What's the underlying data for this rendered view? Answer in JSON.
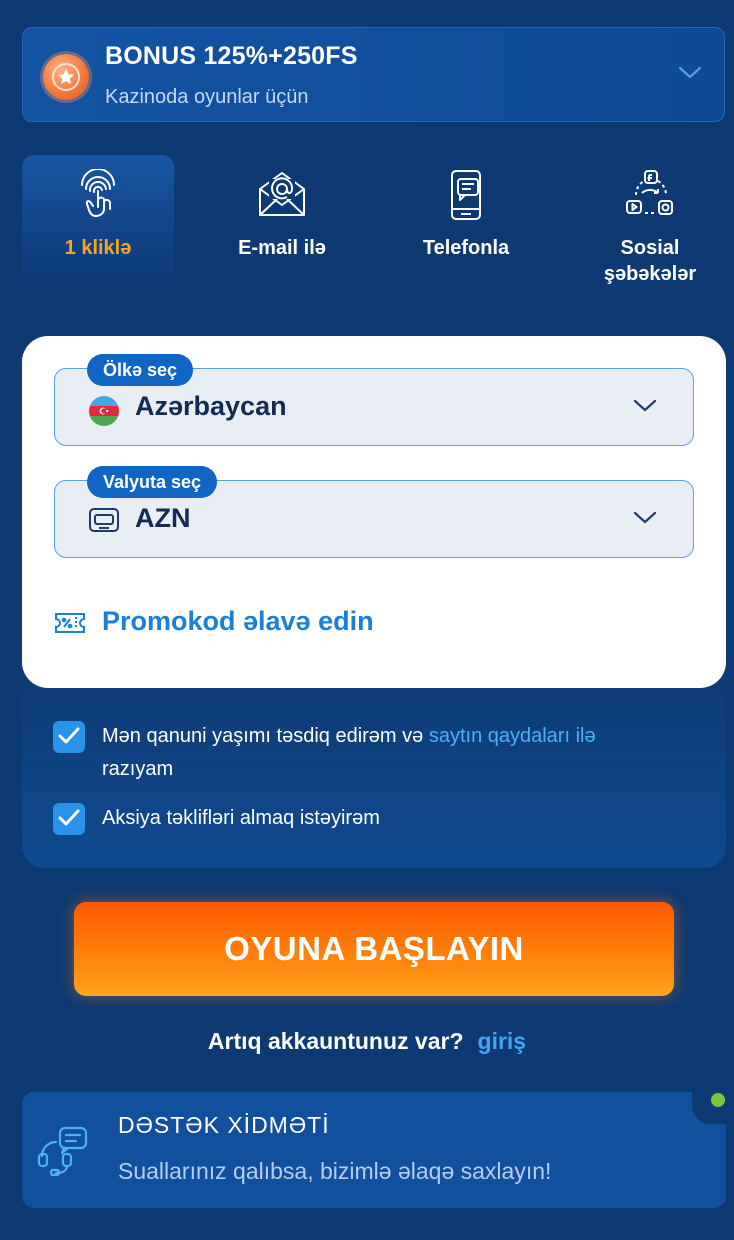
{
  "bonus": {
    "title": "BONUS 125%+250FS",
    "subtitle": "Kazinoda oyunlar üçün",
    "icon": "star-medal-icon"
  },
  "tabs": [
    {
      "label": "1 kliklə",
      "icon": "fingerprint-tap-icon",
      "active": true
    },
    {
      "label": "E-mail ilə",
      "icon": "email-envelope-icon",
      "active": false
    },
    {
      "label": "Telefonla",
      "icon": "phone-icon",
      "active": false
    },
    {
      "label": "Sosial şəbəkələr",
      "icon": "social-networks-icon",
      "active": false
    }
  ],
  "form": {
    "country": {
      "label": "Ölkə seç",
      "value": "Azərbaycan",
      "icon": "azerbaijan-flag-icon"
    },
    "currency": {
      "label": "Valyuta seç",
      "value": "AZN",
      "icon": "currency-card-icon"
    },
    "promo": {
      "label": "Promokod əlavə edin",
      "icon": "promo-ticket-icon"
    }
  },
  "checkboxes": {
    "age": {
      "text": "Mən qanuni yaşımı təsdiq edirəm və ",
      "link": "saytın qaydaları ilə",
      "text_end": "razıyam",
      "checked": true
    },
    "promo": {
      "text": "Aksiya təklifləri almaq istəyirəm",
      "checked": true
    }
  },
  "cta": {
    "label": "OYUNA BAŞLAYIN"
  },
  "login": {
    "question": "Artıq akkauntunuz var?",
    "link": "giriş"
  },
  "support": {
    "title": "DƏSTƏK XİDMƏTİ",
    "subtitle": "Suallarınız qalıbsa, bizimlə əlaqə saxlayın!",
    "icon": "support-headset-chat-icon"
  },
  "colors": {
    "background": "#0d3a72",
    "accent_orange": "#ff7a0a",
    "active_tab": "#f5a524",
    "link_blue": "#3ea6f5",
    "online": "#7cc43a"
  }
}
